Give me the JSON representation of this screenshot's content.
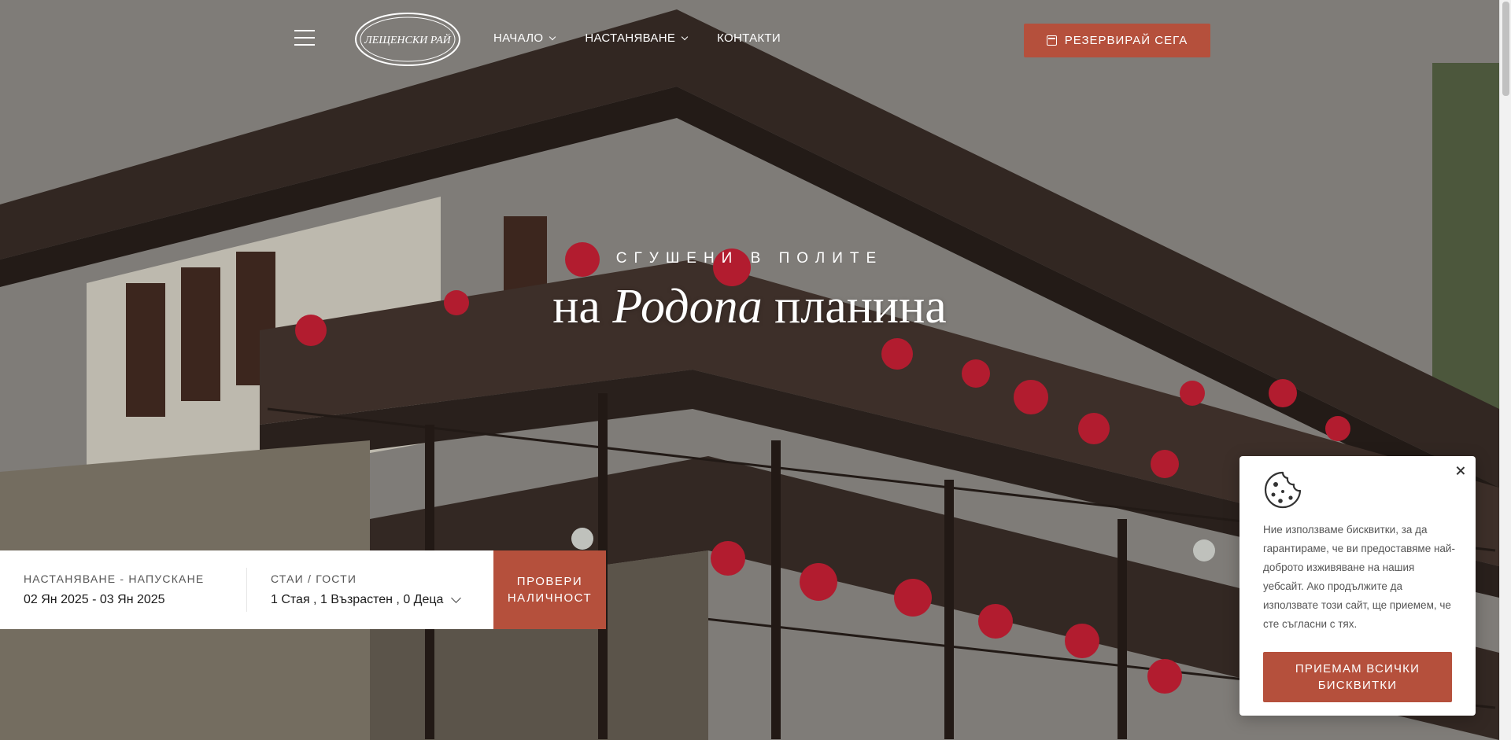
{
  "header": {
    "menu_icon": "hamburger-icon",
    "logo_text": "ЛЕЩЕНСКИ РАЙ",
    "nav": [
      {
        "label": "НАЧАЛО",
        "has_dropdown": true
      },
      {
        "label": "НАСТАНЯВАНЕ",
        "has_dropdown": true
      },
      {
        "label": "КОНТАКТИ",
        "has_dropdown": false
      }
    ],
    "book_button": {
      "label": "РЕЗЕРВИРАЙ СЕГА",
      "icon": "calendar-icon"
    }
  },
  "hero": {
    "kicker": "СГУШЕНИ В ПОЛИТЕ",
    "headline_pre": "на ",
    "headline_em": "Родопа",
    "headline_post": " планина"
  },
  "booking": {
    "dates_label": "НАСТАНЯВАНЕ - НАПУСКАНЕ",
    "dates_value": "02 Ян 2025 - 03 Ян 2025",
    "guests_label": "СТАИ / ГОСТИ",
    "guests_value": "1 Стая , 1 Възрастен , 0 Деца",
    "check_button": "ПРОВЕРИ НАЛИЧНОСТ"
  },
  "cookie": {
    "icon": "cookie-icon",
    "text": "Ние използваме бисквитки, за да гарантираме, че ви предоставяме най-доброто изживяване на нашия уебсайт. Ако продължите да използвате този сайт, ще приемем, че сте съгласни с тях.",
    "accept_button": "ПРИЕМАМ ВСИЧКИ БИСКВИТКИ"
  },
  "colors": {
    "accent": "#b5503c",
    "panel_bg": "#ffffff",
    "text_dark": "#1b1b1b",
    "text_muted": "#555555"
  }
}
